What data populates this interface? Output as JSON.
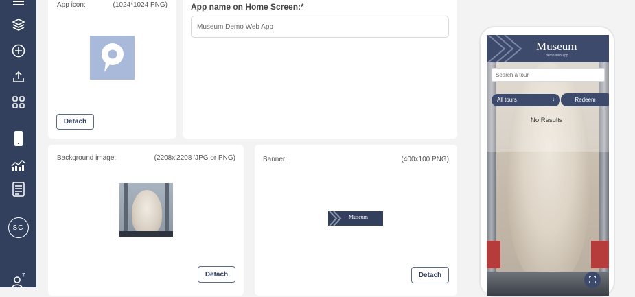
{
  "sidebar": {
    "items": [
      {
        "name": "menu-icon"
      },
      {
        "name": "layers-icon"
      },
      {
        "name": "add-circle-icon"
      },
      {
        "name": "upload-icon"
      },
      {
        "name": "apps-grid-icon"
      },
      {
        "name": "mobile-phone-icon"
      },
      {
        "name": "analytics-icon"
      },
      {
        "name": "checklist-icon"
      }
    ],
    "avatar_initials": "SC",
    "users_icon_badge": "7"
  },
  "app_icon": {
    "label": "App icon:",
    "size_hint": "(1024*1024 PNG)",
    "detach_label": "Detach",
    "color": "#a9b9d9"
  },
  "app_name": {
    "label": "App name on Home Screen:*",
    "value": "Museum Demo Web App"
  },
  "background_image": {
    "label": "Background image:",
    "size_hint": "(2208x'2208 'JPG or PNG)",
    "detach_label": "Detach"
  },
  "banner": {
    "label": "Banner:",
    "size_hint": "(400x100 PNG)",
    "thumb_text": "Museum",
    "detach_label": "Detach"
  },
  "preview": {
    "title": "Museum",
    "subtitle": "demo web app",
    "search_placeholder": "Search a tour",
    "filter_label": "All tours",
    "filter_arrow": "↓",
    "redeem_label": "Redeem",
    "no_results": "No Results"
  },
  "colors": {
    "sidebar": "#33405d",
    "accent": "#33405d",
    "page_bg": "#f3f3f4"
  }
}
